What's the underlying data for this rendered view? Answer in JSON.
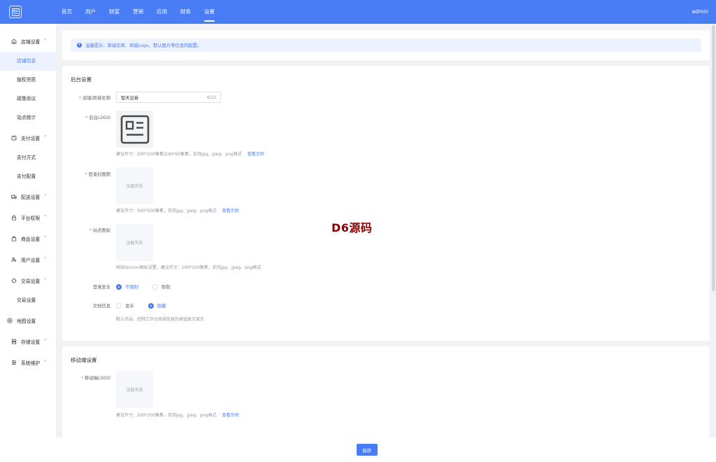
{
  "header": {
    "nav": [
      "首页",
      "用户",
      "财富",
      "营销",
      "应用",
      "财务",
      "设置"
    ],
    "active_nav": "设置",
    "user": "admin",
    "bg_color": "#4a7cf5"
  },
  "sidebar": {
    "shop_settings": "店铺设置",
    "shop_info": "店铺信息",
    "copyright": "版权资质",
    "policy": "政策协议",
    "site_stats": "站点统计",
    "payment_settings": "支付设置",
    "payment_methods": "支付方式",
    "payment_config": "支付配置",
    "delivery_settings": "配送设置",
    "platform_perms": "平台权限",
    "product_settings": "商品设置",
    "user_settings": "用户设置",
    "trade_settings": "交易设置",
    "trade_settings_sub": "交易设置",
    "map_settings": "地图设置",
    "storage_settings": "存储设置",
    "system_maintenance": "系统维护"
  },
  "notice": {
    "text": "温馨提示：商城名称、商城Logo、默认图片等信息的配置。"
  },
  "backend": {
    "title": "后台设置",
    "shop_name_label": "店铺/商城名称",
    "shop_name_value": "智天证券",
    "shop_name_count": "4/12",
    "logo_label": "后台LOGO",
    "logo_hint": "建议尺寸：200*200像素/240*60像素，支持jpg、jpeg、png格式",
    "logo_link": "查看示例",
    "login_cover_label": "登录封面图",
    "load_failed": "加载失败",
    "login_cover_hint": "建议尺寸：500*500像素，支持jpg、jpeg、png格式",
    "login_cover_link": "查看示例",
    "site_icon_label": "站点图标",
    "site_icon_hint": "网站favicon图标设置，建议尺寸：100*100像素，支持jpg、jpeg、png格式",
    "login_security_label": "登录安全",
    "login_security_options": [
      "不限制",
      "限制"
    ],
    "login_security_selected": 0,
    "copyright_label": "文档信息",
    "copyright_options": [
      "显示",
      "隐藏"
    ],
    "copyright_selected": 1,
    "copyright_hint": "默认开启，控制工作台商城信息的按钮显示显示"
  },
  "mobile": {
    "title": "移动端设置",
    "logo_label": "移动端LOGO",
    "load_failed": "加载失败",
    "logo_hint": "建议尺寸：200*200像素，支持jpg、jpeg、png格式",
    "logo_link": "查看示例"
  },
  "watermark": "D6源码",
  "footer": {
    "save_label": "保存"
  }
}
